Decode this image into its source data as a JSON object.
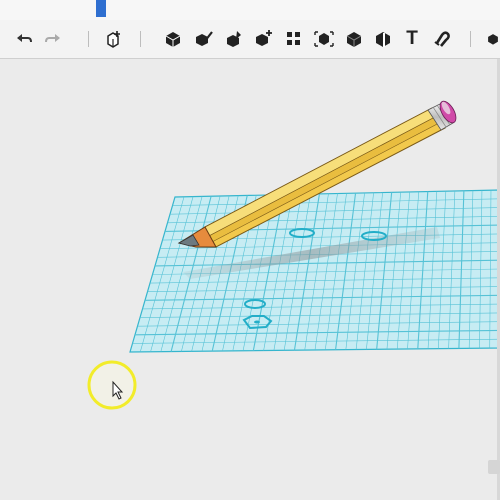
{
  "toolbar": {
    "items": [
      {
        "name": "undo-icon",
        "glyph": "undo"
      },
      {
        "name": "redo-icon",
        "glyph": "redo"
      },
      {
        "name": "insert-shape-icon",
        "glyph": "insert"
      },
      {
        "name": "shape-tool-icon",
        "glyph": "cube"
      },
      {
        "name": "sketch-tool-icon",
        "glyph": "cube-pen"
      },
      {
        "name": "modify-tool-icon",
        "glyph": "cube-edit"
      },
      {
        "name": "transform-tool-icon",
        "glyph": "cube-plus"
      },
      {
        "name": "pattern-tool-icon",
        "glyph": "pattern"
      },
      {
        "name": "group-tool-icon",
        "glyph": "group"
      },
      {
        "name": "combine-tool-icon",
        "glyph": "cube-solid"
      },
      {
        "name": "measure-tool-icon",
        "glyph": "cube-split"
      },
      {
        "name": "text-tool-icon",
        "glyph": "T"
      },
      {
        "name": "snap-tool-icon",
        "glyph": "magnet"
      },
      {
        "name": "material-tool-icon",
        "glyph": "cube"
      }
    ],
    "text_label": "T"
  },
  "colors": {
    "grid": "#39b8cf",
    "grid_fill": "#bfe9f1",
    "pencil_body": "#f3cf55",
    "pencil_wood": "#e68b3d",
    "pencil_lead": "#6d7a80",
    "pencil_ferrule": "#d9d9d9",
    "pencil_eraser": "#d04aa8",
    "cursor_highlight": "#f2ec2a"
  }
}
